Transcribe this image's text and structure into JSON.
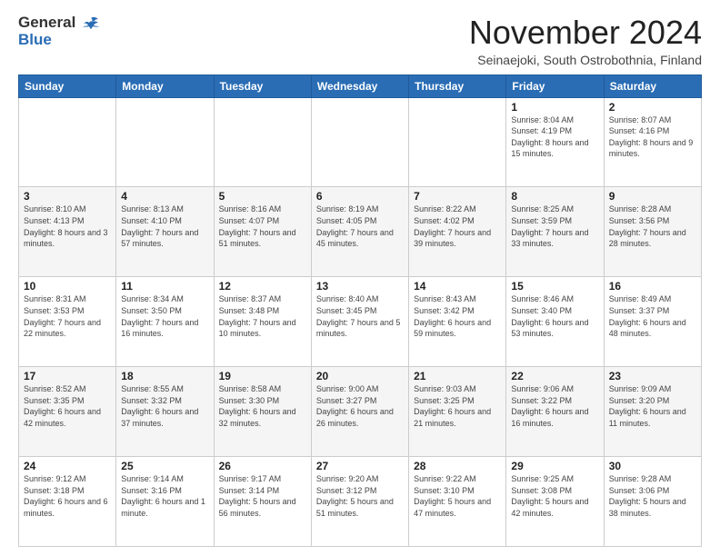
{
  "header": {
    "logo_line1": "General",
    "logo_line2": "Blue",
    "month_title": "November 2024",
    "subtitle": "Seinaejoki, South Ostrobothnia, Finland"
  },
  "weekdays": [
    "Sunday",
    "Monday",
    "Tuesday",
    "Wednesday",
    "Thursday",
    "Friday",
    "Saturday"
  ],
  "weeks": [
    [
      {
        "day": "",
        "info": ""
      },
      {
        "day": "",
        "info": ""
      },
      {
        "day": "",
        "info": ""
      },
      {
        "day": "",
        "info": ""
      },
      {
        "day": "",
        "info": ""
      },
      {
        "day": "1",
        "info": "Sunrise: 8:04 AM\nSunset: 4:19 PM\nDaylight: 8 hours and 15 minutes."
      },
      {
        "day": "2",
        "info": "Sunrise: 8:07 AM\nSunset: 4:16 PM\nDaylight: 8 hours and 9 minutes."
      }
    ],
    [
      {
        "day": "3",
        "info": "Sunrise: 8:10 AM\nSunset: 4:13 PM\nDaylight: 8 hours and 3 minutes."
      },
      {
        "day": "4",
        "info": "Sunrise: 8:13 AM\nSunset: 4:10 PM\nDaylight: 7 hours and 57 minutes."
      },
      {
        "day": "5",
        "info": "Sunrise: 8:16 AM\nSunset: 4:07 PM\nDaylight: 7 hours and 51 minutes."
      },
      {
        "day": "6",
        "info": "Sunrise: 8:19 AM\nSunset: 4:05 PM\nDaylight: 7 hours and 45 minutes."
      },
      {
        "day": "7",
        "info": "Sunrise: 8:22 AM\nSunset: 4:02 PM\nDaylight: 7 hours and 39 minutes."
      },
      {
        "day": "8",
        "info": "Sunrise: 8:25 AM\nSunset: 3:59 PM\nDaylight: 7 hours and 33 minutes."
      },
      {
        "day": "9",
        "info": "Sunrise: 8:28 AM\nSunset: 3:56 PM\nDaylight: 7 hours and 28 minutes."
      }
    ],
    [
      {
        "day": "10",
        "info": "Sunrise: 8:31 AM\nSunset: 3:53 PM\nDaylight: 7 hours and 22 minutes."
      },
      {
        "day": "11",
        "info": "Sunrise: 8:34 AM\nSunset: 3:50 PM\nDaylight: 7 hours and 16 minutes."
      },
      {
        "day": "12",
        "info": "Sunrise: 8:37 AM\nSunset: 3:48 PM\nDaylight: 7 hours and 10 minutes."
      },
      {
        "day": "13",
        "info": "Sunrise: 8:40 AM\nSunset: 3:45 PM\nDaylight: 7 hours and 5 minutes."
      },
      {
        "day": "14",
        "info": "Sunrise: 8:43 AM\nSunset: 3:42 PM\nDaylight: 6 hours and 59 minutes."
      },
      {
        "day": "15",
        "info": "Sunrise: 8:46 AM\nSunset: 3:40 PM\nDaylight: 6 hours and 53 minutes."
      },
      {
        "day": "16",
        "info": "Sunrise: 8:49 AM\nSunset: 3:37 PM\nDaylight: 6 hours and 48 minutes."
      }
    ],
    [
      {
        "day": "17",
        "info": "Sunrise: 8:52 AM\nSunset: 3:35 PM\nDaylight: 6 hours and 42 minutes."
      },
      {
        "day": "18",
        "info": "Sunrise: 8:55 AM\nSunset: 3:32 PM\nDaylight: 6 hours and 37 minutes."
      },
      {
        "day": "19",
        "info": "Sunrise: 8:58 AM\nSunset: 3:30 PM\nDaylight: 6 hours and 32 minutes."
      },
      {
        "day": "20",
        "info": "Sunrise: 9:00 AM\nSunset: 3:27 PM\nDaylight: 6 hours and 26 minutes."
      },
      {
        "day": "21",
        "info": "Sunrise: 9:03 AM\nSunset: 3:25 PM\nDaylight: 6 hours and 21 minutes."
      },
      {
        "day": "22",
        "info": "Sunrise: 9:06 AM\nSunset: 3:22 PM\nDaylight: 6 hours and 16 minutes."
      },
      {
        "day": "23",
        "info": "Sunrise: 9:09 AM\nSunset: 3:20 PM\nDaylight: 6 hours and 11 minutes."
      }
    ],
    [
      {
        "day": "24",
        "info": "Sunrise: 9:12 AM\nSunset: 3:18 PM\nDaylight: 6 hours and 6 minutes."
      },
      {
        "day": "25",
        "info": "Sunrise: 9:14 AM\nSunset: 3:16 PM\nDaylight: 6 hours and 1 minute."
      },
      {
        "day": "26",
        "info": "Sunrise: 9:17 AM\nSunset: 3:14 PM\nDaylight: 5 hours and 56 minutes."
      },
      {
        "day": "27",
        "info": "Sunrise: 9:20 AM\nSunset: 3:12 PM\nDaylight: 5 hours and 51 minutes."
      },
      {
        "day": "28",
        "info": "Sunrise: 9:22 AM\nSunset: 3:10 PM\nDaylight: 5 hours and 47 minutes."
      },
      {
        "day": "29",
        "info": "Sunrise: 9:25 AM\nSunset: 3:08 PM\nDaylight: 5 hours and 42 minutes."
      },
      {
        "day": "30",
        "info": "Sunrise: 9:28 AM\nSunset: 3:06 PM\nDaylight: 5 hours and 38 minutes."
      }
    ]
  ]
}
